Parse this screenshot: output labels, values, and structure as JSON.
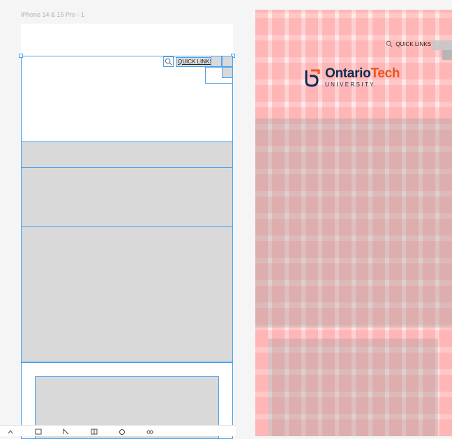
{
  "frame": {
    "label": "iPhone 14 & 15 Pro - 1"
  },
  "header": {
    "quick_links": "QUICK LINKS"
  },
  "preview": {
    "quick_links": "QUICK LINKS",
    "logo": {
      "word1": "Ontario",
      "word2": "Tech",
      "subtitle": "UNIVERSITY"
    }
  },
  "colors": {
    "selection": "#4aa3f0",
    "brand_blue": "#0d2c54",
    "brand_orange": "#e8551e"
  },
  "toolbar": {
    "icons": [
      "move-icon",
      "frame-icon",
      "pen-icon",
      "table-icon",
      "comment-icon",
      "plugins-icon"
    ]
  }
}
